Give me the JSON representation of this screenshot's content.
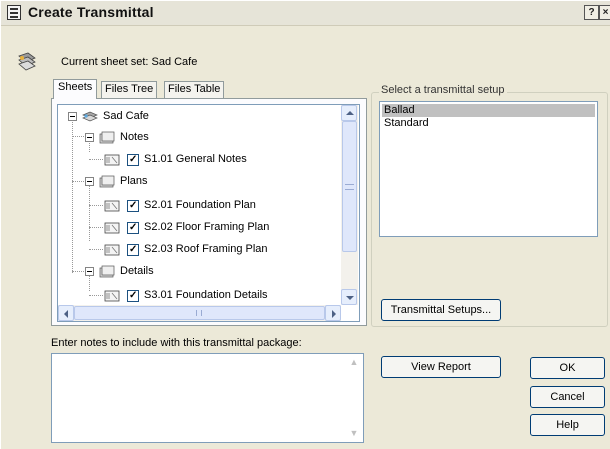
{
  "window": {
    "title": "Create Transmittal",
    "help_glyph": "?",
    "close_glyph": "×"
  },
  "header": {
    "current_sheet_set_label": "Current sheet set: Sad Cafe"
  },
  "tabs": [
    {
      "label": "Sheets",
      "active": true
    },
    {
      "label": "Files Tree",
      "active": false
    },
    {
      "label": "Files Table",
      "active": false
    }
  ],
  "tree": {
    "root": "Sad Cafe",
    "nodes": [
      {
        "type": "folder",
        "label": "Notes"
      },
      {
        "type": "sheet",
        "label": "S1.01 General Notes",
        "checked": true
      },
      {
        "type": "folder",
        "label": "Plans"
      },
      {
        "type": "sheet",
        "label": "S2.01 Foundation Plan",
        "checked": true
      },
      {
        "type": "sheet",
        "label": "S2.02 Floor Framing Plan",
        "checked": true
      },
      {
        "type": "sheet",
        "label": "S2.03 Roof Framing Plan",
        "checked": true
      },
      {
        "type": "folder",
        "label": "Details"
      },
      {
        "type": "sheet",
        "label": "S3.01 Foundation Details",
        "checked": true
      }
    ]
  },
  "setup_group": {
    "label": "Select a transmittal setup",
    "items": [
      {
        "label": "Ballad",
        "selected": true
      },
      {
        "label": "Standard",
        "selected": false
      }
    ],
    "setups_button": "Transmittal Setups..."
  },
  "notes": {
    "label": "Enter notes to include with this transmittal package:",
    "value": ""
  },
  "buttons": {
    "view_report": "View Report",
    "ok": "OK",
    "cancel": "Cancel",
    "help": "Help"
  }
}
